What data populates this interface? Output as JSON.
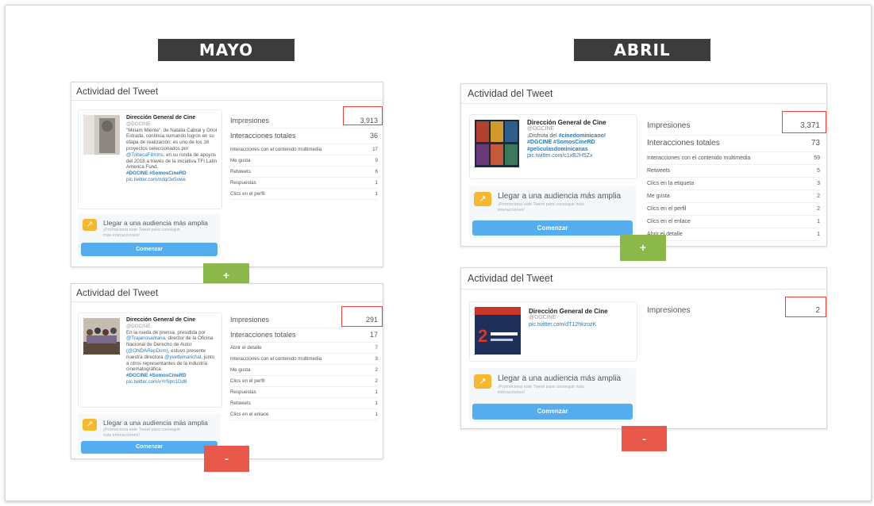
{
  "headers": {
    "mayo": "MAYO",
    "abril": "ABRIL"
  },
  "card_title": "Actividad del Tweet",
  "promo": {
    "title": "Llegar a una audiencia más amplia",
    "subtitle": "¡Promociona este Tweet para conseguir más interacciones!",
    "button": "Comenzar"
  },
  "buttons": {
    "plus": "+",
    "minus": "-"
  },
  "colors": {
    "header_bg": "#3c3c3c",
    "plus_bg": "#8cb84b",
    "minus_bg": "#e8584b",
    "button_blue": "#55acee",
    "highlight": "#e8453c"
  },
  "mayo_top": {
    "author": "Dirección General de Cine",
    "handle": "@DGCINE",
    "text": "\"Miriam Miente\", de Natalia Cabral y Oriol Estrada, continúa sumando logros en su etapa de realización: es uno de los 16 proyectos seleccionados por",
    "mention": "@TribecaFilmIns",
    "text2": ", en su ronda de apoyos del 2018 a través de la iniciativa TFI Latin America Fund.",
    "tags": "#DGCINE #SomosCineRD",
    "link": "pic.twitter.com/ndqr3e5owe",
    "metrics": [
      {
        "label": "Impresiones",
        "value": "3,913"
      },
      {
        "label": "Interacciones totales",
        "value": "36"
      },
      {
        "label": "Interacciones con el contenido multimedia",
        "value": "17"
      },
      {
        "label": "Me gusta",
        "value": "9"
      },
      {
        "label": "Retweets",
        "value": "6"
      },
      {
        "label": "Respuestas",
        "value": "1"
      },
      {
        "label": "Clics en el perfil",
        "value": "1"
      }
    ]
  },
  "mayo_bottom": {
    "author": "Dirección General de Cine",
    "handle": "@DGCINE",
    "text": "En la rueda de prensa, presidida por",
    "mention1": "@Trajanosantana",
    "text2": ", director de la Oficina Nacional de Derecho de Autor",
    "mention2": "(@ONDARepDom)",
    "text3": ", estuvo presente nuestra directora",
    "mention3": "@yvettemarichal",
    "text4": ", junto a otros representantes de la industria cinematográfica.",
    "tags": "#DGCINE #SomosCineRD",
    "link": "pic.twitter.com/vYrNpn1Dd8",
    "metrics": [
      {
        "label": "Impresiones",
        "value": "291"
      },
      {
        "label": "Interacciones totales",
        "value": "17"
      },
      {
        "label": "Abrir el detalle",
        "value": "7"
      },
      {
        "label": "Interacciones con el contenido multimedia",
        "value": "3"
      },
      {
        "label": "Me gusta",
        "value": "2"
      },
      {
        "label": "Clics en el perfil",
        "value": "2"
      },
      {
        "label": "Respuestas",
        "value": "1"
      },
      {
        "label": "Retweets",
        "value": "1"
      },
      {
        "label": "Clics en el enlace",
        "value": "1"
      }
    ]
  },
  "abril_top": {
    "author": "Dirección General de Cine",
    "handle": "@DGCINE",
    "text": "¡Disfruta del",
    "tag1": "#cinedominicano!",
    "tags": "#DGCINE #SomosCineRD #peliculasdominicanas",
    "link": "pic.twitter.com/c1xB2H5Zx",
    "metrics": [
      {
        "label": "Impresiones",
        "value": "3,371"
      },
      {
        "label": "Interacciones totales",
        "value": "73"
      },
      {
        "label": "Interacciones con el contenido multimedia",
        "value": "59"
      },
      {
        "label": "Retweets",
        "value": "5"
      },
      {
        "label": "Clics en la etiqueta",
        "value": "3"
      },
      {
        "label": "Me gusta",
        "value": "2"
      },
      {
        "label": "Clics en el perfil",
        "value": "2"
      },
      {
        "label": "Clics en el enlace",
        "value": "1"
      },
      {
        "label": "Abrir el detalle",
        "value": "1"
      }
    ]
  },
  "abril_bottom": {
    "author": "Dirección General de Cine",
    "handle": "@DGCINE",
    "link": "pic.twitter.com/dT12hkzozK",
    "metrics": [
      {
        "label": "Impresiones",
        "value": "2"
      }
    ]
  }
}
